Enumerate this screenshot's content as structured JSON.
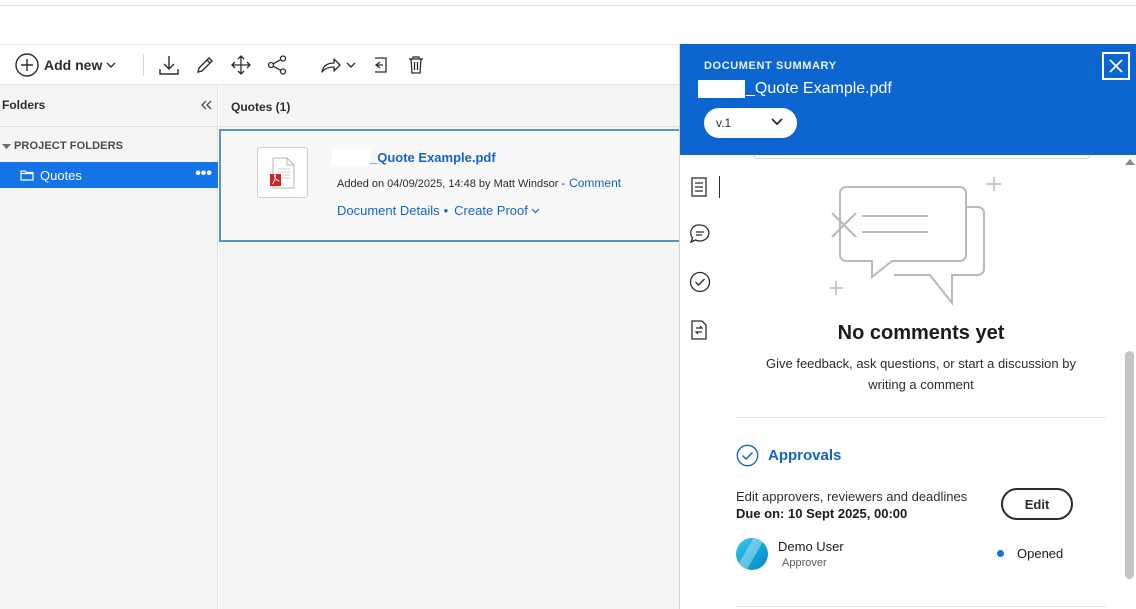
{
  "toolbar": {
    "add_new_label": "Add new",
    "icons": [
      "plus-circle-icon",
      "chevron-down-icon",
      "download-icon",
      "pencil-icon",
      "move-icon",
      "share-icon",
      "forward-icon",
      "chevron-down-icon",
      "exit-icon",
      "trash-icon"
    ]
  },
  "sidebar": {
    "title": "Folders",
    "section_label": "PROJECT FOLDERS",
    "items": [
      {
        "label": "Quotes",
        "more": "•••"
      }
    ]
  },
  "center": {
    "title": "Quotes (1)",
    "file": {
      "name": "_Quote Example.pdf",
      "added": "Added on 04/09/2025, 14:48 by Matt Windsor -",
      "comment_link": "Comment",
      "details_link": "Document Details",
      "separator": "•",
      "create_proof_link": "Create Proof"
    }
  },
  "summary": {
    "label": "DOCUMENT SUMMARY",
    "doc_title": "_Quote Example.pdf",
    "version": "v.1",
    "no_comments_title": "No comments yet",
    "no_comments_text": "Give feedback, ask questions, or start a discussion by writing a comment",
    "approvals_title": "Approvals",
    "approvals_edit_text": "Edit approvers, reviewers and deadlines",
    "due": "Due on: 10 Sept 2025, 00:00",
    "edit_button": "Edit",
    "user_name": "Demo User",
    "user_role": "Approver",
    "user_status": "Opened"
  },
  "colors": {
    "accent": "#1473e6",
    "header_blue": "#0d66d0",
    "link_blue": "#1565c0",
    "status_blue": "#1473e6"
  }
}
